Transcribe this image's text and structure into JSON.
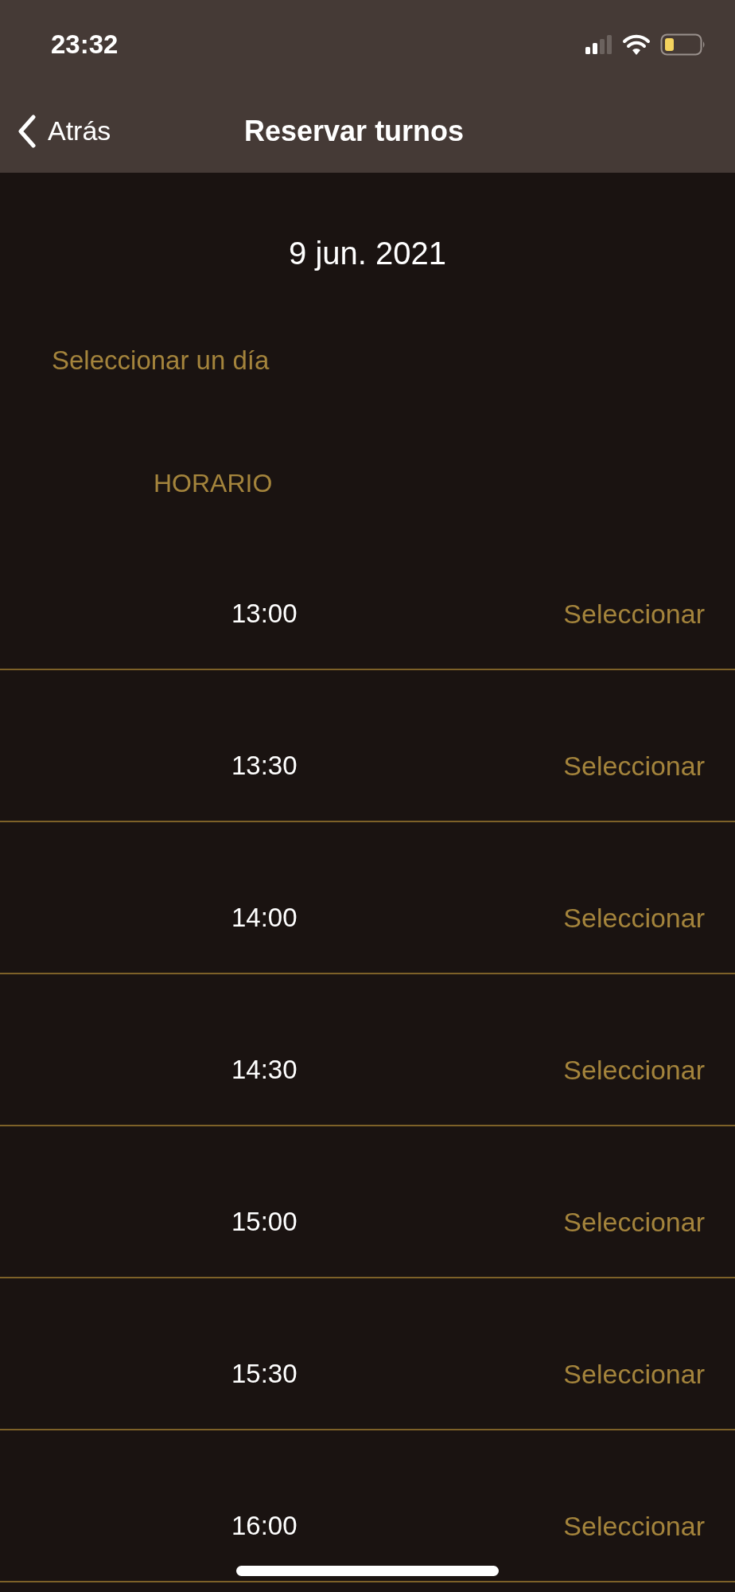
{
  "status_bar": {
    "time": "23:32"
  },
  "nav": {
    "back": "Atrás",
    "title": "Reservar turnos"
  },
  "date": "9 jun. 2021",
  "select_day": "Seleccionar un día",
  "schedule_header": "HORARIO",
  "slots": [
    {
      "time": "13:00",
      "action": "Seleccionar"
    },
    {
      "time": "13:30",
      "action": "Seleccionar"
    },
    {
      "time": "14:00",
      "action": "Seleccionar"
    },
    {
      "time": "14:30",
      "action": "Seleccionar"
    },
    {
      "time": "15:00",
      "action": "Seleccionar"
    },
    {
      "time": "15:30",
      "action": "Seleccionar"
    },
    {
      "time": "16:00",
      "action": "Seleccionar"
    }
  ]
}
